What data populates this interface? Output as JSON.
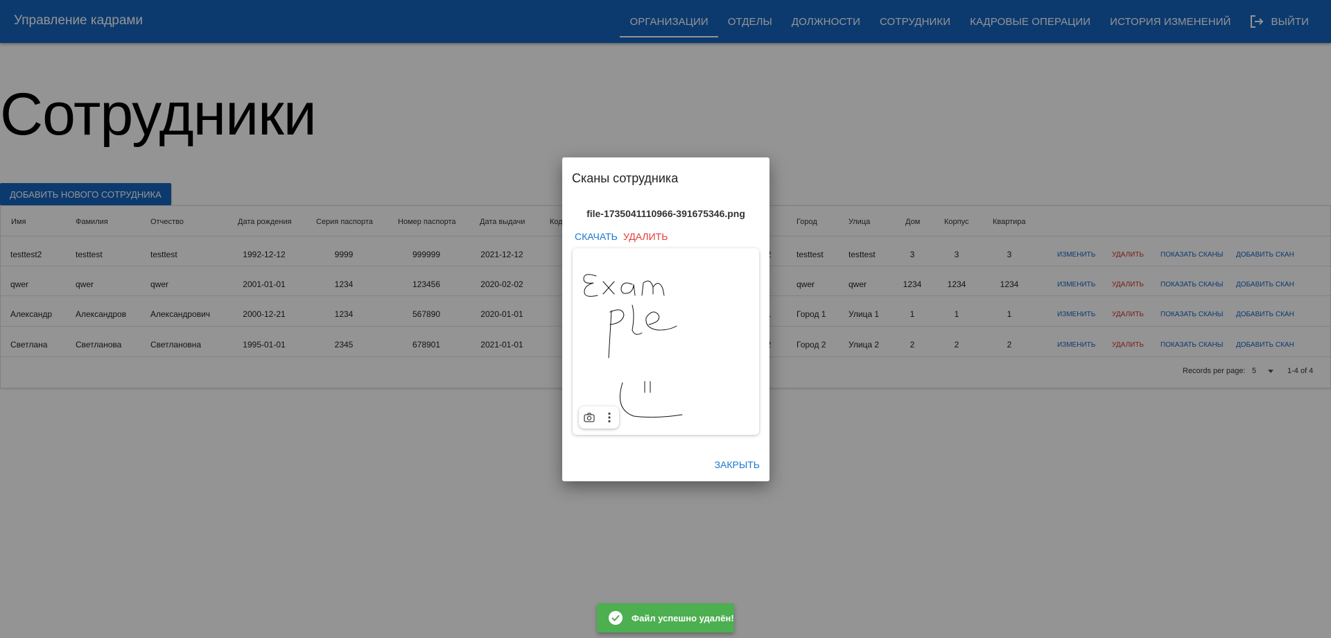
{
  "app": {
    "title": "Управление кадрами",
    "nav": [
      {
        "label": "Организации",
        "active": true
      },
      {
        "label": "Отделы",
        "active": false
      },
      {
        "label": "Должности",
        "active": false
      },
      {
        "label": "Сотрудники",
        "active": false
      },
      {
        "label": "Кадровые операции",
        "active": false
      },
      {
        "label": "История изменений",
        "active": false
      }
    ],
    "logout_label": "Выйти"
  },
  "page": {
    "title": "Сотрудники",
    "add_button": "Добавить нового сотрудника"
  },
  "table": {
    "headers": [
      "Имя",
      "Фамилия",
      "Отчество",
      "Дата рождения",
      "Серия паспорта",
      "Номер паспорта",
      "Дата выдачи",
      "Код",
      "Город",
      "Улица",
      "Дом",
      "Корпус",
      "Квартира"
    ],
    "rows": [
      {
        "first": "testtest2",
        "last": "testtest",
        "middle": "testtest",
        "birth": "1992-12-12",
        "series": "9999",
        "number": "999999",
        "issued": "2021-12-12",
        "code_tail": "2",
        "city": "testtest",
        "street": "testtest",
        "house": "3",
        "building": "3",
        "apt": "3"
      },
      {
        "first": "qwer",
        "last": "qwer",
        "middle": "qwer",
        "birth": "2001-01-01",
        "series": "1234",
        "number": "123456",
        "issued": "2020-02-02",
        "code_tail": "",
        "city": "qwer",
        "street": "qwer",
        "house": "1234",
        "building": "1234",
        "apt": "1234"
      },
      {
        "first": "Александр",
        "last": "Александров",
        "middle": "Александрович",
        "birth": "2000-12-21",
        "series": "1234",
        "number": "567890",
        "issued": "2020-01-01",
        "code_tail": "1",
        "city": "Город 1",
        "street": "Улица 1",
        "house": "1",
        "building": "1",
        "apt": "1"
      },
      {
        "first": "Светлана",
        "last": "Светланова",
        "middle": "Светлановна",
        "birth": "1995-01-01",
        "series": "2345",
        "number": "678901",
        "issued": "2021-01-01",
        "code_tail": "2",
        "city": "Город 2",
        "street": "Улица 2",
        "house": "2",
        "building": "2",
        "apt": "2"
      }
    ],
    "actions": {
      "edit": "Изменить",
      "delete": "Удалить",
      "show_scans": "Показать сканы",
      "add_scan": "Добавить скан"
    },
    "footer": {
      "records_label": "Records per page:",
      "records_value": "5",
      "range": "1-4 of 4"
    }
  },
  "dialog": {
    "title": "Сканы сотрудника",
    "file_name": "file-1735041110966-391675346.png",
    "download_label": "Скачать",
    "delete_label": "Удалить",
    "close_label": "Закрыть"
  },
  "snackbar": {
    "text": "Файл успешно удалён!"
  },
  "colors": {
    "primary": "#1565c0",
    "danger": "#d32f2f",
    "success": "#4caf50"
  },
  "icons": [
    "logout-icon",
    "camera-icon",
    "more-vert-icon",
    "check-circle-icon"
  ]
}
